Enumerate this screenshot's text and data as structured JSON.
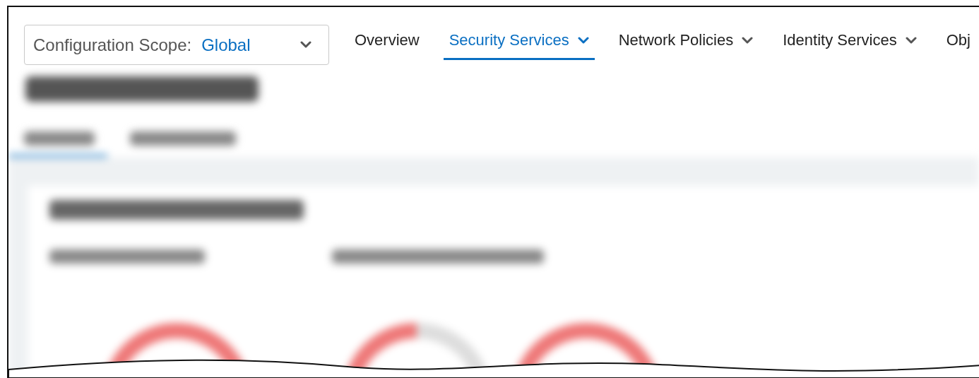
{
  "scope": {
    "label": "Configuration Scope:",
    "value": "Global"
  },
  "nav": [
    {
      "label": "Overview",
      "selected": false,
      "has_menu": false
    },
    {
      "label": "Security Services",
      "selected": true,
      "has_menu": true
    },
    {
      "label": "Network Policies",
      "selected": false,
      "has_menu": true
    },
    {
      "label": "Identity Services",
      "selected": false,
      "has_menu": true
    },
    {
      "label": "Obj",
      "selected": false,
      "has_menu": false
    }
  ]
}
